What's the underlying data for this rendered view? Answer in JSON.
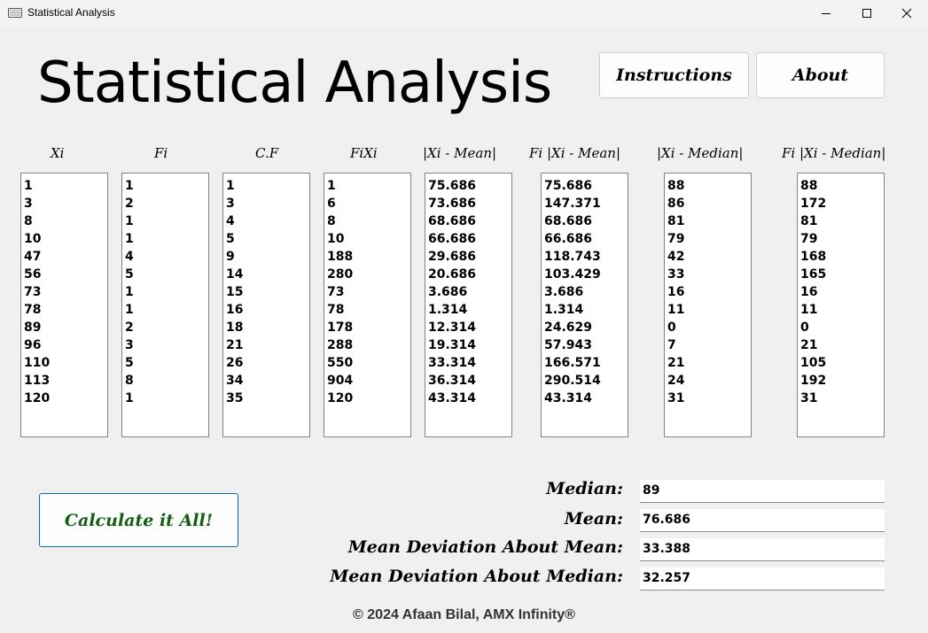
{
  "window": {
    "title": "Statistical Analysis",
    "minimize_icon": "minimize-icon",
    "maximize_icon": "maximize-icon",
    "close_icon": "close-icon"
  },
  "header": {
    "title": "Statistical Analysis",
    "instructions_label": "Instructions",
    "about_label": "About"
  },
  "columns": [
    {
      "name": "Xi",
      "values": [
        "1",
        "3",
        "8",
        "10",
        "47",
        "56",
        "73",
        "78",
        "89",
        "96",
        "110",
        "113",
        "120"
      ]
    },
    {
      "name": "Fi",
      "values": [
        "1",
        "2",
        "1",
        "1",
        "4",
        "5",
        "1",
        "1",
        "2",
        "3",
        "5",
        "8",
        "1"
      ]
    },
    {
      "name": "C.F",
      "values": [
        "1",
        "3",
        "4",
        "5",
        "9",
        "14",
        "15",
        "16",
        "18",
        "21",
        "26",
        "34",
        "35"
      ]
    },
    {
      "name": "FiXi",
      "values": [
        "1",
        "6",
        "8",
        "10",
        "188",
        "280",
        "73",
        "78",
        "178",
        "288",
        "550",
        "904",
        "120"
      ]
    },
    {
      "name": "|Xi - Mean|",
      "values": [
        "75.686",
        "73.686",
        "68.686",
        "66.686",
        "29.686",
        "20.686",
        "3.686",
        "1.314",
        "12.314",
        "19.314",
        "33.314",
        "36.314",
        "43.314"
      ]
    },
    {
      "name": "Fi |Xi - Mean|",
      "values": [
        "75.686",
        "147.371",
        "68.686",
        "66.686",
        "118.743",
        "103.429",
        "3.686",
        "1.314",
        "24.629",
        "57.943",
        "166.571",
        "290.514",
        "43.314"
      ]
    },
    {
      "name": "|Xi - Median|",
      "values": [
        "88",
        "86",
        "81",
        "79",
        "42",
        "33",
        "16",
        "11",
        "0",
        "7",
        "21",
        "24",
        "31"
      ]
    },
    {
      "name": "Fi |Xi - Median|",
      "values": [
        "88",
        "172",
        "81",
        "79",
        "168",
        "165",
        "16",
        "11",
        "0",
        "21",
        "105",
        "192",
        "31"
      ]
    }
  ],
  "actions": {
    "calculate_label": "Calculate it All!"
  },
  "results": {
    "median_label": "Median:",
    "median_value": "89",
    "mean_label": "Mean:",
    "mean_value": "76.686",
    "md_mean_label": "Mean Deviation About Mean:",
    "md_mean_value": "33.388",
    "md_median_label": "Mean Deviation About Median:",
    "md_median_value": "32.257"
  },
  "footer": {
    "text": "© 2024 Afaan Bilal, AMX Infinity®"
  },
  "colors": {
    "background": "#f0f0f0",
    "calc_text": "#106010",
    "calc_border": "#0f6cbd"
  }
}
